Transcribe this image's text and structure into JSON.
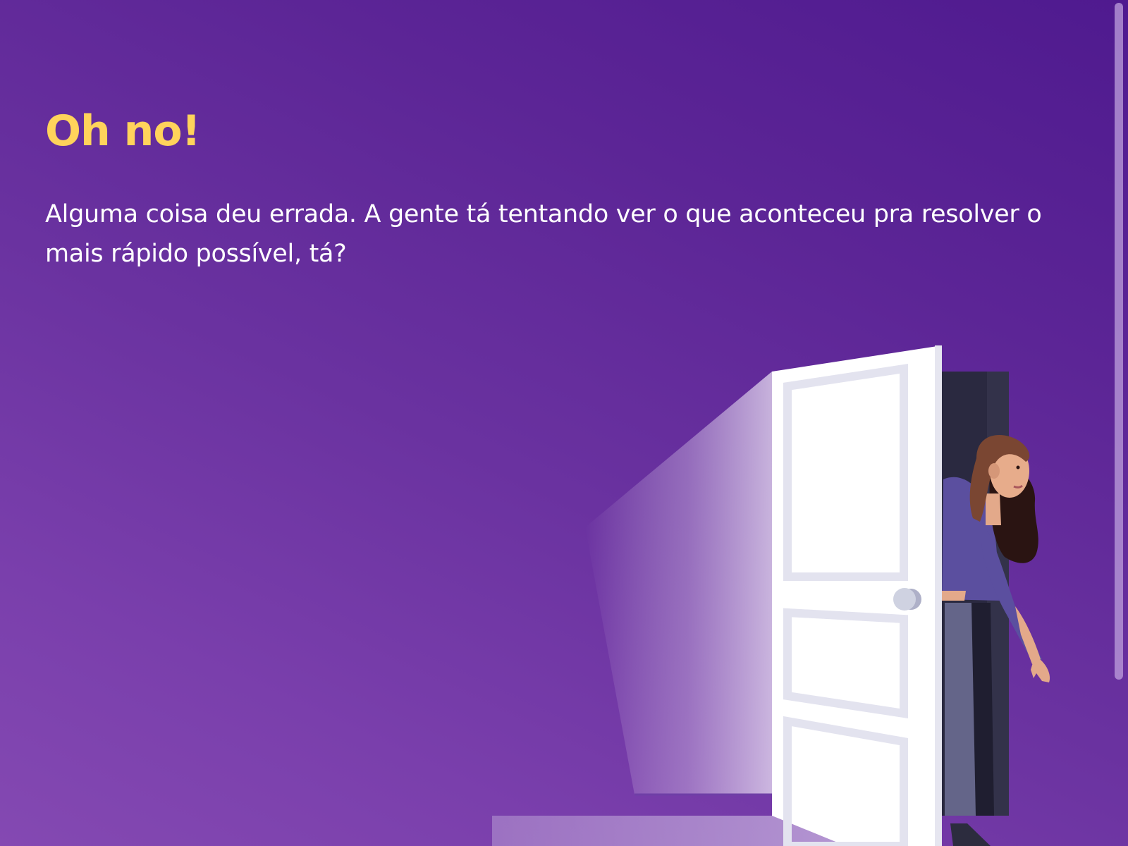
{
  "error": {
    "title": "Oh no!",
    "message": "Alguma coisa deu errada. A gente tá tentando ver o que aconteceu pra resolver o mais rápido possível, tá?"
  },
  "colors": {
    "title": "#ffd35b",
    "text": "#ffffff",
    "background_start": "#4f1a8f",
    "background_end": "#8449b2"
  },
  "illustration": {
    "subject": "woman-peeking-through-open-door-icon"
  }
}
